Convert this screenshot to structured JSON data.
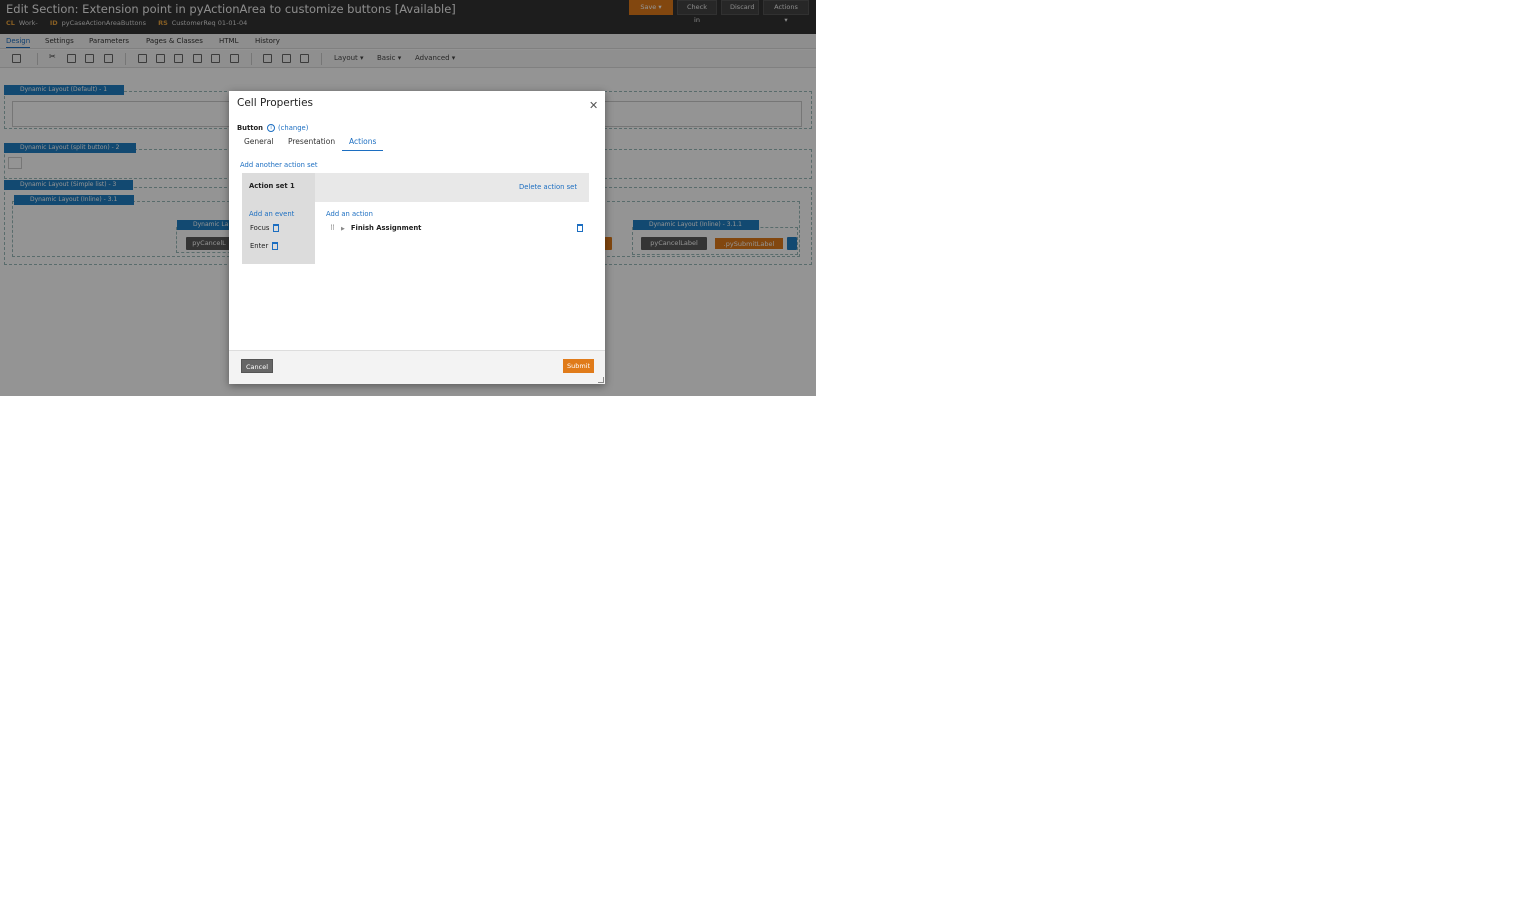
{
  "header": {
    "title": "Edit Section: Extension point in pyActionArea to customize buttons [Available]",
    "meta": [
      {
        "key": "CL",
        "value": "Work-"
      },
      {
        "key": "ID",
        "value": "pyCaseActionAreaButtons"
      },
      {
        "key": "RS",
        "value": "CustomerReq 01-01-04"
      }
    ],
    "buttons": {
      "save": "Save",
      "checkin": "Check in",
      "discard": "Discard",
      "actions": "Actions"
    }
  },
  "tabs": [
    "Design",
    "Settings",
    "Parameters",
    "Pages & Classes",
    "HTML",
    "History"
  ],
  "toolbar": {
    "layout": "Layout",
    "basic": "Basic",
    "advanced": "Advanced"
  },
  "canvas": {
    "layouts": [
      "Dynamic Layout (Default) - 1",
      "Dynamic Layout (split button) - 2",
      "Dynamic Layout (Simple list) - 3",
      "Dynamic Layout (Inline) - 3.1",
      "Dynamic La",
      "Dynamic Layout (Inline) - 3.1.1"
    ],
    "buttons": {
      "cancel_a": "pyCancelL",
      "cancel_b": "pyCancelLabel",
      "submit_b": ".pySubmitLabel"
    }
  },
  "modal": {
    "title": "Cell Properties",
    "control_type": "Button",
    "change_link": "(change)",
    "tabs": [
      "General",
      "Presentation",
      "Actions"
    ],
    "active_tab": "Actions",
    "add_action_set": "Add another action set",
    "action_set": {
      "name": "Action set 1",
      "delete": "Delete action set",
      "add_event": "Add an event",
      "events": [
        "Focus",
        "Enter"
      ],
      "add_action": "Add an action",
      "action": "Finish Assignment"
    },
    "cancel": "Cancel",
    "submit": "Submit"
  },
  "colors": {
    "accent": "#1c6ec1",
    "submit": "#e07b1a",
    "header_bg": "#333333",
    "layout_label": "#1f7fc3"
  }
}
